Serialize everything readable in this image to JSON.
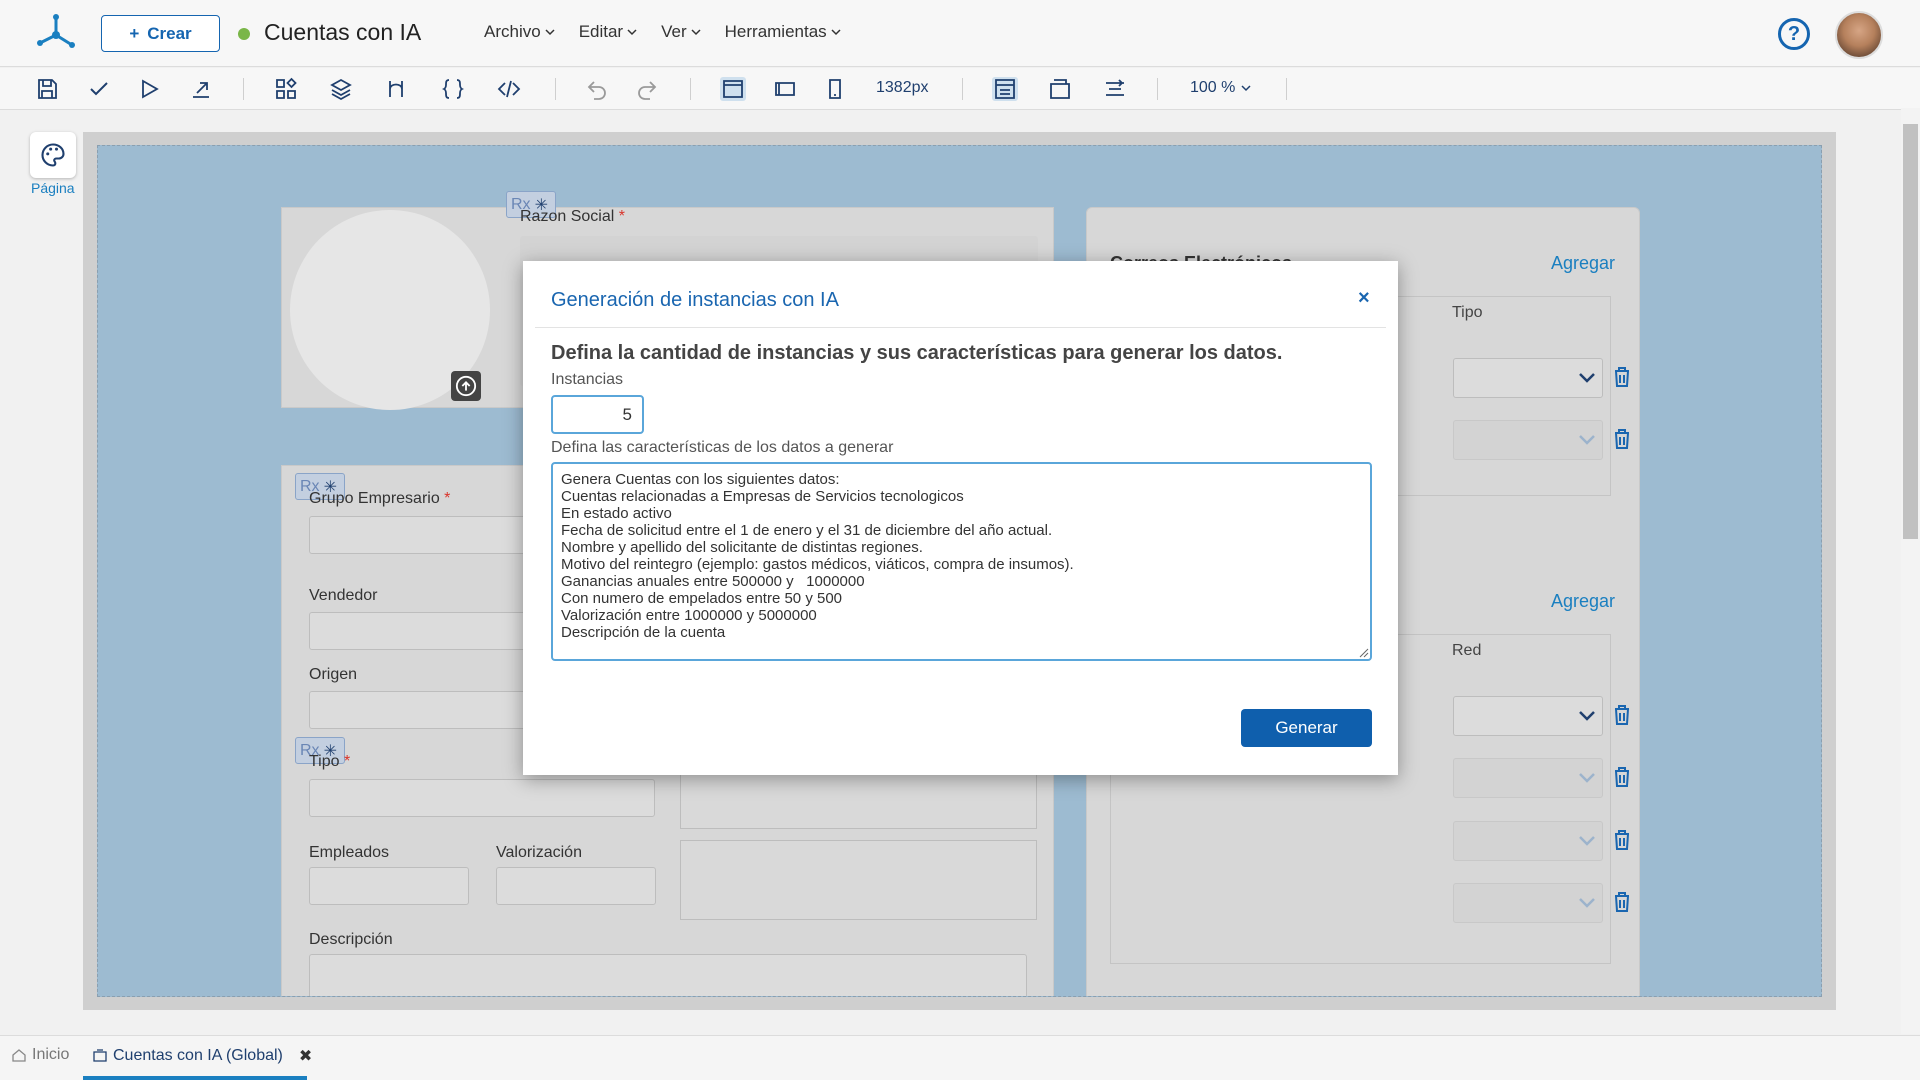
{
  "header": {
    "create_label": "Crear",
    "app_title": "Cuentas con IA",
    "menu": [
      "Archivo",
      "Editar",
      "Ver",
      "Herramientas"
    ],
    "help_symbol": "?"
  },
  "toolbar": {
    "width_value": "1382px",
    "zoom_value": "100 %"
  },
  "sidebar": {
    "page_label": "Página"
  },
  "form": {
    "rx_label": "Rx",
    "razon_social": "Razon Social",
    "grupo_empresario": "Grupo Empresario",
    "vendedor": "Vendedor",
    "origen": "Origen",
    "tipo_field": "Tipo",
    "empleados": "Empleados",
    "valorizacion": "Valorización",
    "descripcion": "Descripción",
    "required_mark": "*",
    "correos_title": "Correos Electrónicos",
    "agregar": "Agregar",
    "col_tipo": "Tipo",
    "col_red": "Red"
  },
  "modal": {
    "title": "Generación de instancias con IA",
    "close": "×",
    "heading": "Defina la cantidad de instancias y sus características para generar los datos.",
    "instances_label": "Instancias",
    "instances_value": "5",
    "characteristics_label": "Defina las características de los datos a generar",
    "characteristics_text": "Genera Cuentas con los siguientes datos:\nCuentas relacionadas a Empresas de Servicios tecnologicos\nEn estado activo\nFecha de solicitud entre el 1 de enero y el 31 de diciembre del año actual.\nNombre y apellido del solicitante de distintas regiones.\nMotivo del reintegro (ejemplo: gastos médicos, viáticos, compra de insumos).\nGanancias anuales entre 500000 y   1000000\nCon numero de empelados entre 50 y 500\nValorización entre 1000000 y 5000000\nDescripción de la cuenta",
    "generate_label": "Generar"
  },
  "bottom_tabs": {
    "home": "Inicio",
    "active": "Cuentas con IA (Global)",
    "close": "✖"
  },
  "colors": {
    "accent": "#1565b0",
    "canvas_bg": "#9dbbd1",
    "status_dot": "#7ab648"
  },
  "icons": [
    "app-logo-icon",
    "plus-icon",
    "chevron-down-icon",
    "help-icon",
    "save-icon",
    "check-icon",
    "play-icon",
    "export-icon",
    "components-icon",
    "layers-icon",
    "flow-icon",
    "braces-icon",
    "code-icon",
    "undo-icon",
    "redo-icon",
    "desktop-icon",
    "tablet-icon",
    "mobile-icon",
    "layout-icon",
    "window-icon",
    "align-icon",
    "palette-icon",
    "upload-icon",
    "asterisk-icon",
    "trash-icon",
    "home-icon",
    "tab-icon",
    "close-icon"
  ]
}
